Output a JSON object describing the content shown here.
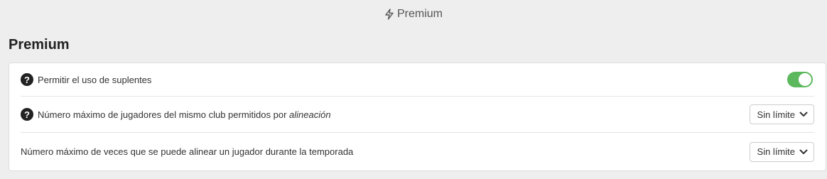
{
  "header": {
    "icon": "lightning-icon",
    "title": "Premium"
  },
  "section": {
    "title": "Premium"
  },
  "settings": [
    {
      "label": "Permitir el uso de suplentes",
      "has_help": true,
      "control": "toggle",
      "toggle_on": true,
      "toggle_color": "#5cb85c"
    },
    {
      "label_prefix": "Número máximo de jugadores del mismo club permitidos por ",
      "label_emphasis": "alineación",
      "has_help": true,
      "control": "select",
      "select_value": "Sin límite"
    },
    {
      "label": "Número máximo de veces que se puede alinear un jugador durante la temporada",
      "has_help": false,
      "control": "select",
      "select_value": "Sin límite"
    }
  ]
}
